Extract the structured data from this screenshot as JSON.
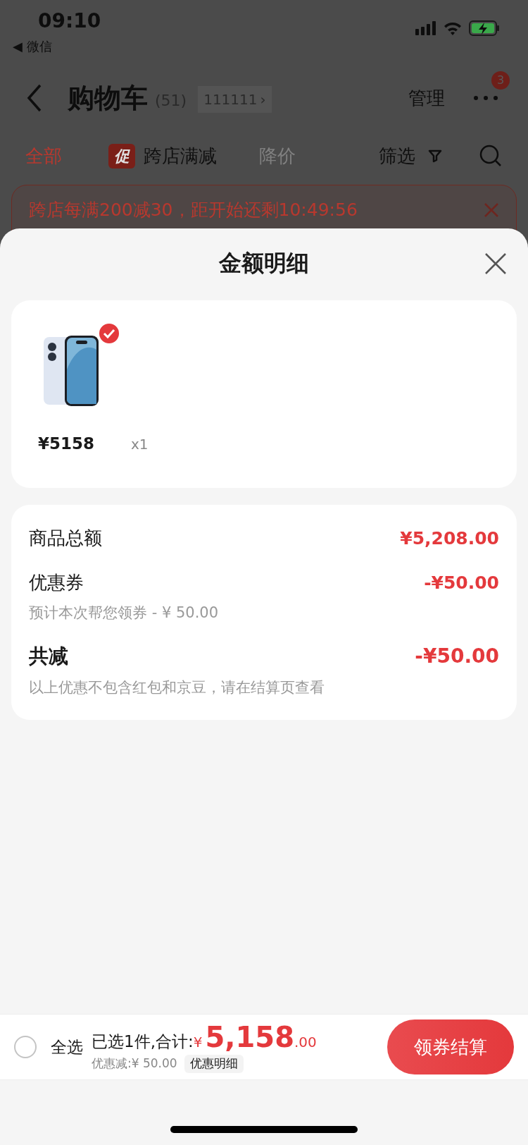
{
  "status_bar": {
    "time": "09:10",
    "back_app": "◀ 微信"
  },
  "header": {
    "title": "购物车",
    "count": "(51)",
    "address": "111111",
    "address_arrow": "›",
    "manage": "管理",
    "more_badge": "3"
  },
  "filter_tabs": [
    {
      "label": "全部",
      "kind": "tab",
      "selected": true,
      "disabled": false
    },
    {
      "label": "跨店满减",
      "kind": "promo",
      "badge": "促",
      "selected": false,
      "disabled": false
    },
    {
      "label": "降价",
      "kind": "tab",
      "selected": false,
      "disabled": true
    },
    {
      "label": "筛选",
      "kind": "filter",
      "selected": false,
      "disabled": false
    }
  ],
  "promo_banner": {
    "text": "跨店每满200减30，距开始还剩10:49:56"
  },
  "sheet": {
    "title": "金额明细",
    "products": [
      {
        "price": "¥5158",
        "quantity": "x1",
        "checked": true
      }
    ],
    "summary": [
      {
        "label": "商品总额",
        "value": "¥5,208.00",
        "kind": "normal"
      },
      {
        "label": "优惠券",
        "value": "-¥50.00",
        "note": "预计本次帮您领券 - ¥ 50.00",
        "kind": "normal"
      },
      {
        "label": "共减",
        "value": "-¥50.00",
        "note": "以上优惠不包含红包和京豆，请在结算页查看",
        "kind": "total"
      }
    ]
  },
  "bottom_bar": {
    "select_all": "全选",
    "select_all_checked": false,
    "selected_text": "已选1件,合计:",
    "currency": "¥",
    "amount": "5,158",
    "decimals": ".00",
    "discount": "优惠减:¥ 50.00",
    "detail_link": "优惠明细",
    "checkout": "领券结算"
  }
}
